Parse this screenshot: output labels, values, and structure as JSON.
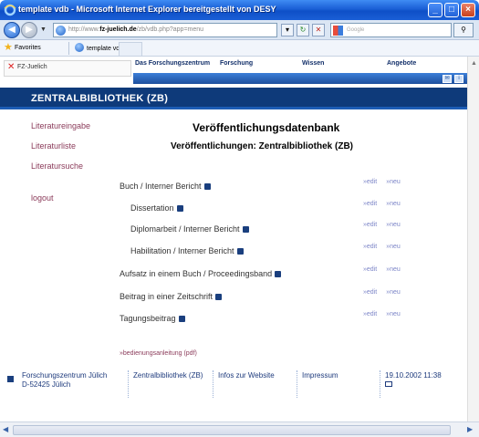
{
  "window": {
    "title": "template vdb - Microsoft Internet Explorer bereitgestellt von DESY",
    "minimize": "_",
    "maximize": "□",
    "close": "×"
  },
  "address_bar": {
    "url_prefix": "http://www.",
    "url_domain": "fz-juelich.de",
    "url_suffix": "/zb/vdb.php?app=menu",
    "search_placeholder": "Google"
  },
  "favorites_bar": {
    "favorites_label": "Favorites",
    "tab_label": "template vdb"
  },
  "site_header": {
    "logo_text": "FZ-Juelich",
    "nav": [
      "Das Forschungszentrum",
      "Forschung",
      "Wissen",
      "Angebote"
    ],
    "banner": "ZENTRALBIBLIOTHEK (ZB)"
  },
  "left_nav": {
    "items": [
      "Literatureingabe",
      "Literaturliste",
      "Literatursuche",
      "logout"
    ]
  },
  "main": {
    "title": "Veröffentlichungsdatenbank",
    "subtitle": "Veröffentlichungen: Zentralbibliothek (ZB)",
    "categories": [
      {
        "label": "Buch / Interner Bericht",
        "edit": "»edit",
        "new": "»neu"
      },
      {
        "label": "Dissertation",
        "edit": "»edit",
        "new": "»neu"
      },
      {
        "label": "Diplomarbeit / Interner Bericht",
        "edit": "»edit",
        "new": "»neu"
      },
      {
        "label": "Habilitation / Interner Bericht",
        "edit": "»edit",
        "new": "»neu"
      },
      {
        "label": "Aufsatz in einem Buch / Proceedingsband",
        "edit": "»edit",
        "new": "»neu"
      },
      {
        "label": "Beitrag in einer Zeitschrift",
        "edit": "»edit",
        "new": "»neu"
      },
      {
        "label": "Tagungsbeitrag",
        "edit": "»edit",
        "new": "»neu"
      }
    ],
    "manual_link": "»bedienungsanleitung (pdf)"
  },
  "footer": {
    "org_line1": "Forschungszentrum Jülich",
    "org_line2": "D-52425 Jülich",
    "col2": "Zentralbibliothek (ZB)",
    "col3": "Infos zur Website",
    "col4": "Impressum",
    "date": "19.10.2002 11:38"
  },
  "colors": {
    "banner": "#0e3a7a",
    "link_maroon": "#8b3b5a",
    "action_link": "#7d86c8"
  }
}
